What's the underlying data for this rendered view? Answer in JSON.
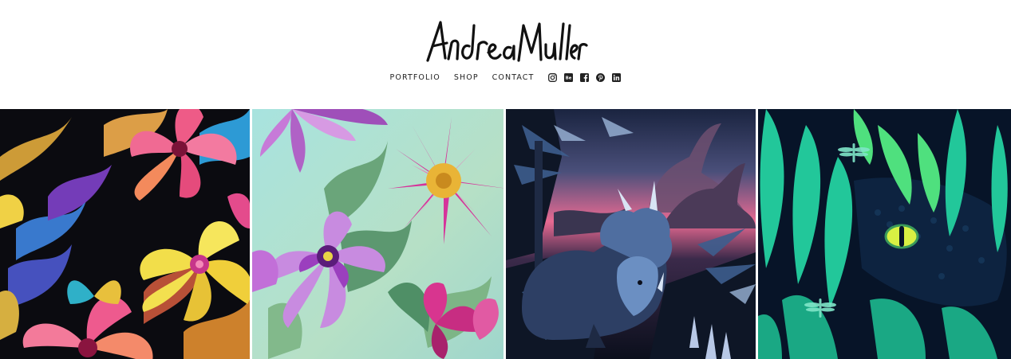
{
  "site": {
    "logo_text": "Andrea Muller"
  },
  "nav": {
    "links": [
      {
        "label": "PORTFOLIO"
      },
      {
        "label": "SHOP"
      },
      {
        "label": "CONTACT"
      }
    ],
    "social": [
      {
        "icon": "instagram-icon"
      },
      {
        "icon": "behance-icon"
      },
      {
        "icon": "facebook-icon"
      },
      {
        "icon": "pinterest-icon"
      },
      {
        "icon": "linkedin-icon"
      }
    ]
  },
  "gallery": {
    "tiles": [
      {
        "subject": "tropical hibiscus pattern",
        "palette": [
          "#0b0b10",
          "#f2e04a",
          "#e8447f",
          "#3aa8e0"
        ]
      },
      {
        "subject": "pink and purple floral pattern",
        "palette": [
          "#a9dfd8",
          "#d6339a",
          "#b27bd6",
          "#6aa57a"
        ]
      },
      {
        "subject": "triceratops night jungle",
        "palette": [
          "#0f1424",
          "#e85a8a",
          "#5f7fb8",
          "#9bb5d8"
        ]
      },
      {
        "subject": "jungle leaves with reptile eye",
        "palette": [
          "#071428",
          "#22c79a",
          "#4fe07e",
          "#d8f043"
        ]
      }
    ]
  },
  "colors": {
    "nav_text": "#222222",
    "background": "#ffffff"
  }
}
